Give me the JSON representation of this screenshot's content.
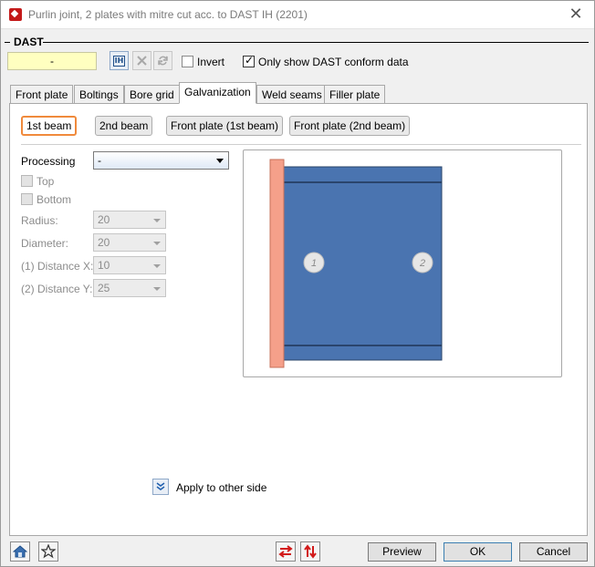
{
  "window": {
    "title": "Purlin joint, 2 plates with mitre cut acc. to DAST IH (2201)",
    "close_glyph": "✕"
  },
  "dast": {
    "group_label": "DAST",
    "value": "-",
    "invert_label": "Invert",
    "invert_checked": false,
    "conform_label": "Only show DAST conform data",
    "conform_checked": true,
    "icons": [
      "ih-icon",
      "delete-icon",
      "refresh-icon"
    ]
  },
  "tabs": [
    {
      "label": "Front plate"
    },
    {
      "label": "Boltings"
    },
    {
      "label": "Bore grid"
    },
    {
      "label": "Galvanization",
      "active": true
    },
    {
      "label": "Weld seams"
    },
    {
      "label": "Filler plate"
    }
  ],
  "subtabs": [
    {
      "label": "1st beam",
      "active": true
    },
    {
      "label": "2nd beam"
    },
    {
      "label": "Front plate (1st beam)"
    },
    {
      "label": "Front plate (2nd beam)"
    }
  ],
  "form": {
    "processing_label": "Processing",
    "processing_value": "-",
    "top_label": "Top",
    "bottom_label": "Bottom",
    "radius_label": "Radius:",
    "radius_value": "20",
    "diameter_label": "Diameter:",
    "diameter_value": "20",
    "dist_x_label": "(1) Distance X:",
    "dist_x_value": "10",
    "dist_y_label": "(2) Distance Y:",
    "dist_y_value": "25"
  },
  "preview": {
    "marker1": "1",
    "marker2": "2",
    "plate_color": "#f5a08a",
    "beam_color": "#4a74b0"
  },
  "apply": {
    "label": "Apply to other side"
  },
  "footer": {
    "preview_label": "Preview",
    "ok_label": "OK",
    "cancel_label": "Cancel"
  }
}
